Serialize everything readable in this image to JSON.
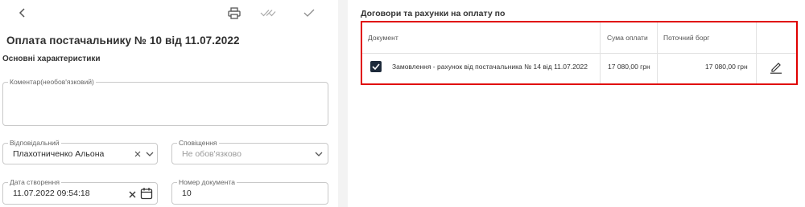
{
  "form": {
    "title": "Оплата постачальнику № 10 від 11.07.2022",
    "section_title": "Основні характеристики",
    "comment": {
      "label": "Коментар(необов'язковий)",
      "value": ""
    },
    "responsible": {
      "label": "Відповідальний",
      "value": "Плахотниченко Альона"
    },
    "notification": {
      "label": "Сповіщення",
      "placeholder": "Не обов'язково"
    },
    "created_date": {
      "label": "Дата створення",
      "value": "11.07.2022 09:54:18"
    },
    "doc_number": {
      "label": "Номер документа",
      "value": "10"
    }
  },
  "toolbar": {
    "back_icon": "chevron-left-icon",
    "print_icon": "printer-icon",
    "double_check_icon": "double-check-icon",
    "check_icon": "check-icon"
  },
  "contracts": {
    "title": "Договори та рахунки на оплату по",
    "columns": [
      "Документ",
      "Сума оплати",
      "Поточний борг"
    ],
    "rows": [
      {
        "checked": true,
        "document": "Замовлення - рахунок від постачальника № 14 від 11.07.2022",
        "amount": "17 080,00 грн",
        "debt": "17 080,00 грн"
      }
    ]
  },
  "colors": {
    "highlight_border": "#e00000",
    "checkbox_fill": "#1d2a3a",
    "panel_gap": "#f3f3f3"
  }
}
